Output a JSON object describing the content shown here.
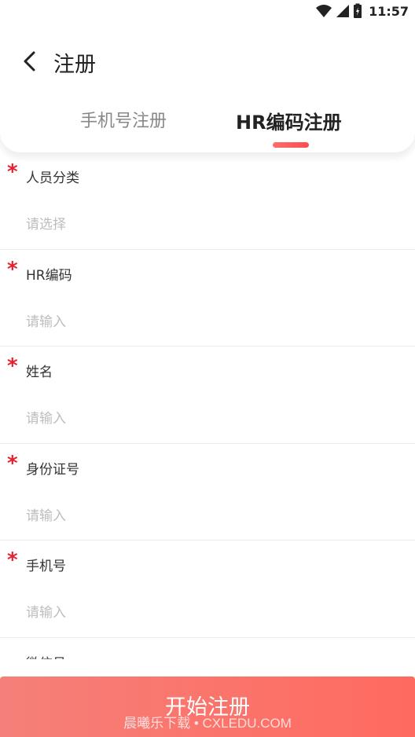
{
  "status_bar": {
    "time": "11:57",
    "icons": [
      "wifi-icon",
      "signal-icon",
      "battery-icon"
    ]
  },
  "header": {
    "back_icon": "chevron-left-icon",
    "title": "注册"
  },
  "tabs": [
    {
      "label": "手机号注册",
      "active": false
    },
    {
      "label": "HR编码注册",
      "active": true
    }
  ],
  "form": {
    "fields": [
      {
        "label": "人员分类",
        "required": true,
        "placeholder": "请选择",
        "type": "select"
      },
      {
        "label": "HR编码",
        "required": true,
        "placeholder": "请输入",
        "type": "input"
      },
      {
        "label": "姓名",
        "required": true,
        "placeholder": "请输入",
        "type": "input"
      },
      {
        "label": "身份证号",
        "required": true,
        "placeholder": "请输入",
        "type": "input"
      },
      {
        "label": "手机号",
        "required": true,
        "placeholder": "请输入",
        "type": "input"
      },
      {
        "label": "微信号",
        "required": false,
        "placeholder": "",
        "type": "input"
      }
    ]
  },
  "submit": {
    "label": "开始注册"
  },
  "watermark": "晨曦乐下载 • CXLEDU.COM",
  "colors": {
    "accent": "#ff5a52",
    "required": "#e8202e",
    "placeholder": "#bdbdbd"
  }
}
